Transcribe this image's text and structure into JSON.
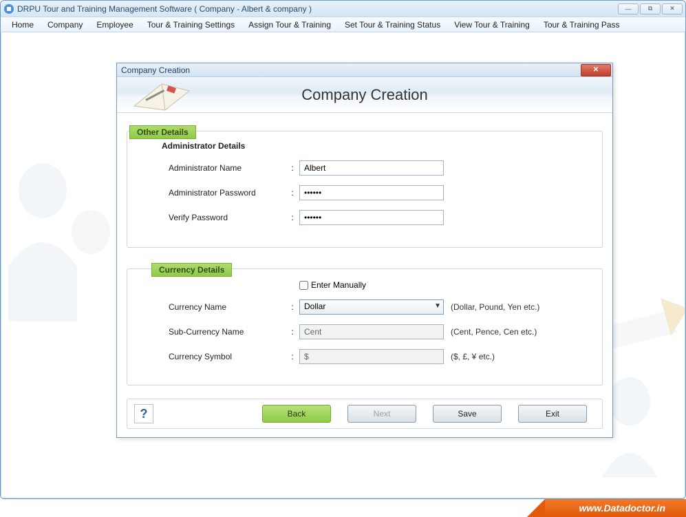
{
  "window": {
    "title": "DRPU Tour and Training Management Software ( Company - Albert & company )"
  },
  "menu": {
    "items": [
      "Home",
      "Company",
      "Employee",
      "Tour & Training Settings",
      "Assign Tour & Training",
      "Set Tour & Training Status",
      "View Tour & Training",
      "Tour & Training Pass"
    ]
  },
  "dialog": {
    "title": "Company Creation",
    "header": "Company Creation",
    "section_other": "Other Details",
    "admin": {
      "group": "Administrator Details",
      "name_label": "Administrator Name",
      "name_value": "Albert",
      "password_label": "Administrator Password",
      "password_value": "••••••",
      "verify_label": "Verify Password",
      "verify_value": "••••••"
    },
    "currency": {
      "section": "Currency Details",
      "manual_label": "Enter Manually",
      "name_label": "Currency Name",
      "name_value": "Dollar",
      "name_hint": "(Dollar, Pound, Yen etc.)",
      "sub_label": "Sub-Currency Name",
      "sub_value": "Cent",
      "sub_hint": "(Cent, Pence, Cen etc.)",
      "symbol_label": "Currency Symbol",
      "symbol_value": "$",
      "symbol_hint": "($, £, ¥ etc.)"
    },
    "buttons": {
      "help": "?",
      "back": "Back",
      "next": "Next",
      "save": "Save",
      "exit": "Exit"
    }
  },
  "footer": {
    "url": "www.Datadoctor.in"
  }
}
